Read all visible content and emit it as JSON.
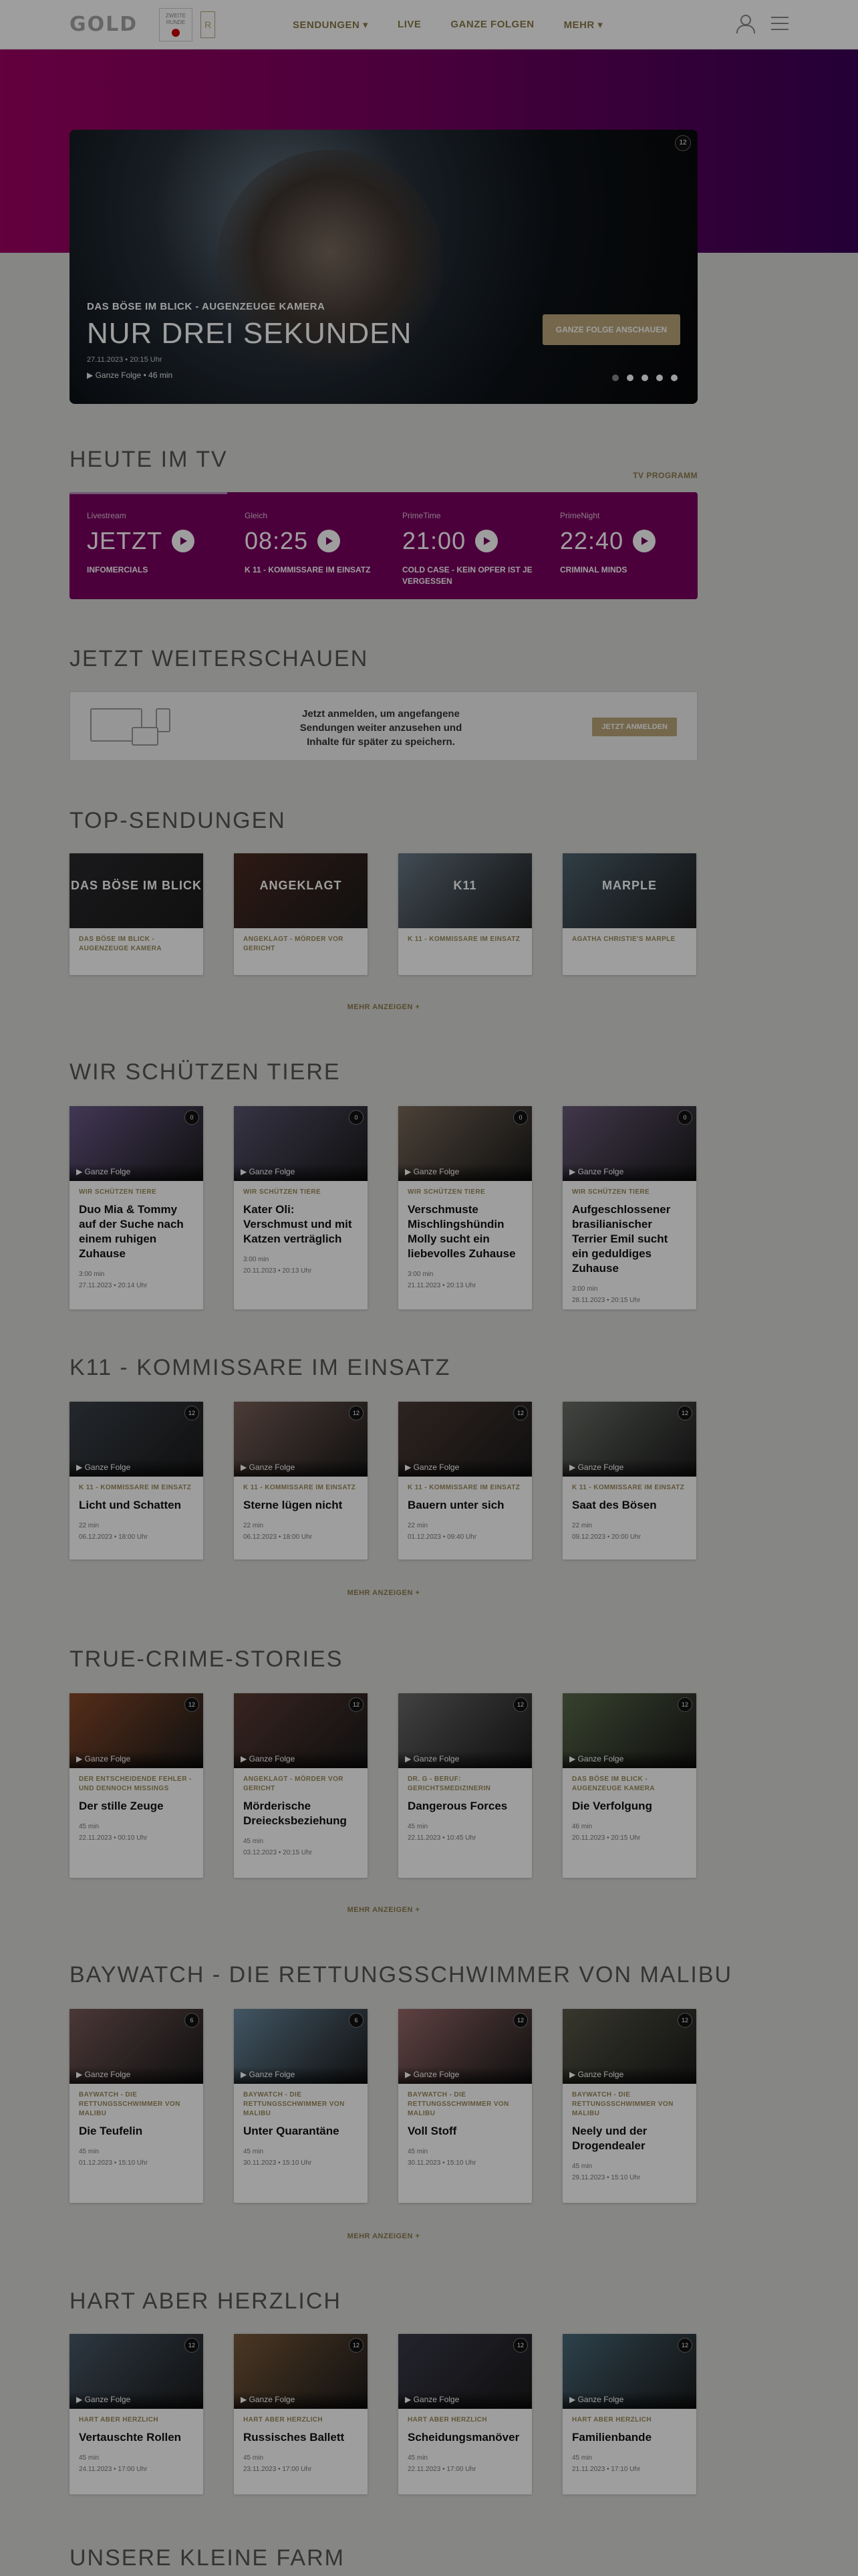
{
  "header": {
    "logo": "GOLD",
    "badge1_text": "ZWEITE RUNDE",
    "badge2_text": "R",
    "nav": [
      "SENDUNGEN ▾",
      "LIVE",
      "GANZE FOLGEN",
      "MEHR ▾"
    ]
  },
  "hero": {
    "kicker": "DAS BÖSE IM BLICK - AUGENZEUGE KAMERA",
    "title": "NUR DREI SEKUNDEN",
    "date": "27.11.2023 • 20:15 Uhr",
    "meta": "▶ Ganze Folge • 46 min",
    "cta": "GANZE FOLGE ANSCHAUEN",
    "age": "12",
    "slide_active": 1,
    "slide_count": 5
  },
  "tv": {
    "title": "HEUTE IM TV",
    "program_link": "TV PROGRAMM",
    "slots": [
      {
        "label": "Livestream",
        "time": "JETZT",
        "show": "INFOMERCIALS"
      },
      {
        "label": "Gleich",
        "time": "08:25",
        "show": "K 11 - KOMMISSARE IM EINSATZ"
      },
      {
        "label": "PrimeTime",
        "time": "21:00",
        "show": "COLD CASE - KEIN OPFER IST JE VERGESSEN"
      },
      {
        "label": "PrimeNight",
        "time": "22:40",
        "show": "CRIMINAL MINDS"
      }
    ]
  },
  "continue": {
    "title": "JETZT WEITERSCHAUEN",
    "text": "Jetzt anmelden, um angefangene Sendungen weiter anzusehen und Inhalte für später zu speichern.",
    "button": "JETZT ANMELDEN"
  },
  "top": {
    "title": "TOP-SENDUNGEN",
    "more": "MEHR ANZEIGEN +",
    "cards": [
      {
        "label": "DAS BÖSE IM BLICK - AUGENZEUGE KAMERA",
        "art": "DAS BÖSE IM BLICK",
        "color": "#2a2a2e"
      },
      {
        "label": "ANGEKLAGT - MÖRDER VOR GERICHT",
        "art": "ANGEKLAGT",
        "color": "#4a2a22"
      },
      {
        "label": "K 11 - KOMMISSARE IM EINSATZ",
        "art": "K11",
        "color": "#6a7a88"
      },
      {
        "label": "AGATHA CHRISTIE'S MARPLE",
        "art": "MARPLE",
        "color": "#4e6470"
      }
    ]
  },
  "tiere": {
    "title": "WIR SCHÜTZEN TIERE",
    "cards": [
      {
        "play": "▶ Ganze Folge",
        "age": "0",
        "cat": "WIR SCHÜTZEN TIERE",
        "title": "Duo Mia & Tommy auf der Suche nach einem ruhigen Zuhause",
        "dur": "3:00 min",
        "date": "27.11.2023 • 20:14 Uhr",
        "color": "#6b5a8a"
      },
      {
        "play": "▶ Ganze Folge",
        "age": "0",
        "cat": "WIR SCHÜTZEN TIERE",
        "title": "Kater Oli: Verschmust und mit Katzen verträglich",
        "dur": "3:00 min",
        "date": "20.11.2023 • 20:13 Uhr",
        "color": "#5a5470"
      },
      {
        "play": "▶ Ganze Folge",
        "age": "0",
        "cat": "WIR SCHÜTZEN TIERE",
        "title": "Verschmuste Mischlingshündin Molly sucht ein liebevolles Zuhause",
        "dur": "3:00 min",
        "date": "21.11.2023 • 20:13 Uhr",
        "color": "#7a6a5a"
      },
      {
        "play": "▶ Ganze Folge",
        "age": "0",
        "cat": "WIR SCHÜTZEN TIERE",
        "title": "Aufgeschlossener brasilianischer Terrier Emil sucht ein geduldiges Zuhause",
        "dur": "3:00 min",
        "date": "28.11.2023 • 20:15 Uhr",
        "color": "#6a5a7a"
      }
    ]
  },
  "k11": {
    "title": "K11 - KOMMISSARE IM EINSATZ",
    "more": "MEHR ANZEIGEN +",
    "cards": [
      {
        "play": "▶ Ganze Folge",
        "age": "12",
        "cat": "K 11 - KOMMISSARE IM EINSATZ",
        "title": "Licht und Schatten",
        "dur": "22 min",
        "date": "06.12.2023 • 18:00 Uhr",
        "color": "#3a4048"
      },
      {
        "play": "▶ Ganze Folge",
        "age": "12",
        "cat": "K 11 - KOMMISSARE IM EINSATZ",
        "title": "Sterne lügen nicht",
        "dur": "22 min",
        "date": "06.12.2023 • 18:00 Uhr",
        "color": "#7a6058"
      },
      {
        "play": "▶ Ganze Folge",
        "age": "12",
        "cat": "K 11 - KOMMISSARE IM EINSATZ",
        "title": "Bauern unter sich",
        "dur": "22 min",
        "date": "01.12.2023 • 09:40 Uhr",
        "color": "#4a3a34"
      },
      {
        "play": "▶ Ganze Folge",
        "age": "12",
        "cat": "K 11 - KOMMISSARE IM EINSATZ",
        "title": "Saat des Bösen",
        "dur": "22 min",
        "date": "09.12.2023 • 20:00 Uhr",
        "color": "#6a7068"
      }
    ]
  },
  "crime": {
    "title": "TRUE-CRIME-STORIES",
    "more": "MEHR ANZEIGEN +",
    "cards": [
      {
        "play": "▶ Ganze Folge",
        "age": "12",
        "cat": "DER ENTSCHEIDENDE FEHLER - UND DENNOCH MISSINGS",
        "title": "Der stille Zeuge",
        "dur": "45 min",
        "date": "22.11.2023 • 00:10 Uhr",
        "color": "#8a4a2a"
      },
      {
        "play": "▶ Ganze Folge",
        "age": "12",
        "cat": "ANGEKLAGT - MÖRDER VOR GERICHT",
        "title": "Mörderische Dreiecksbeziehung",
        "dur": "45 min",
        "date": "03.12.2023 • 20:15 Uhr",
        "color": "#5a3a34"
      },
      {
        "play": "▶ Ganze Folge",
        "age": "12",
        "cat": "DR. G - BERUF: GERICHTSMEDIZINERIN",
        "title": "Dangerous Forces",
        "dur": "45 min",
        "date": "22.11.2023 • 10:45 Uhr",
        "color": "#6a6a6a"
      },
      {
        "play": "▶ Ganze Folge",
        "age": "12",
        "cat": "DAS BÖSE IM BLICK - AUGENZEUGE KAMERA",
        "title": "Die Verfolgung",
        "dur": "46 min",
        "date": "20.11.2023 • 20:15 Uhr",
        "color": "#5a6a4a"
      }
    ]
  },
  "baywatch": {
    "title": "BAYWATCH - DIE RETTUNGSSCHWIMMER VON MALIBU",
    "more": "MEHR ANZEIGEN +",
    "cards": [
      {
        "play": "▶ Ganze Folge",
        "age": "6",
        "cat": "BAYWATCH - DIE RETTUNGSSCHWIMMER VON MALIBU",
        "title": "Die Teufelin",
        "dur": "45 min",
        "date": "01.12.2023 • 15:10 Uhr",
        "color": "#7a5a5a"
      },
      {
        "play": "▶ Ganze Folge",
        "age": "6",
        "cat": "BAYWATCH - DIE RETTUNGSSCHWIMMER VON MALIBU",
        "title": "Unter Quarantäne",
        "dur": "45 min",
        "date": "30.11.2023 • 15:10 Uhr",
        "color": "#6a8aa0"
      },
      {
        "play": "▶ Ganze Folge",
        "age": "12",
        "cat": "BAYWATCH - DIE RETTUNGSSCHWIMMER VON MALIBU",
        "title": "Voll Stoff",
        "dur": "45 min",
        "date": "30.11.2023 • 15:10 Uhr",
        "color": "#9a6a6a"
      },
      {
        "play": "▶ Ganze Folge",
        "age": "12",
        "cat": "BAYWATCH - DIE RETTUNGSSCHWIMMER VON MALIBU",
        "title": "Neely und der Drogendealer",
        "dur": "45 min",
        "date": "29.11.2023 • 15:10 Uhr",
        "color": "#5a5a4a"
      }
    ]
  },
  "hart": {
    "title": "HART ABER HERZLICH",
    "cards": [
      {
        "play": "▶ Ganze Folge",
        "age": "12",
        "cat": "HART ABER HERZLICH",
        "title": "Vertauschte Rollen",
        "dur": "45 min",
        "date": "24.11.2023 • 17:00 Uhr",
        "color": "#4a5a6a"
      },
      {
        "play": "▶ Ganze Folge",
        "age": "12",
        "cat": "HART ABER HERZLICH",
        "title": "Russisches Ballett",
        "dur": "45 min",
        "date": "23.11.2023 • 17:00 Uhr",
        "color": "#7a5a3a"
      },
      {
        "play": "▶ Ganze Folge",
        "age": "12",
        "cat": "HART ABER HERZLICH",
        "title": "Scheidungsmanöver",
        "dur": "45 min",
        "date": "22.11.2023 • 17:00 Uhr",
        "color": "#3a3a4a"
      },
      {
        "play": "▶ Ganze Folge",
        "age": "12",
        "cat": "HART ABER HERZLICH",
        "title": "Familienbande",
        "dur": "45 min",
        "date": "21.11.2023 • 17:10 Uhr",
        "color": "#4a6a7a"
      }
    ]
  },
  "farm": {
    "title": "UNSERE KLEINE FARM"
  }
}
